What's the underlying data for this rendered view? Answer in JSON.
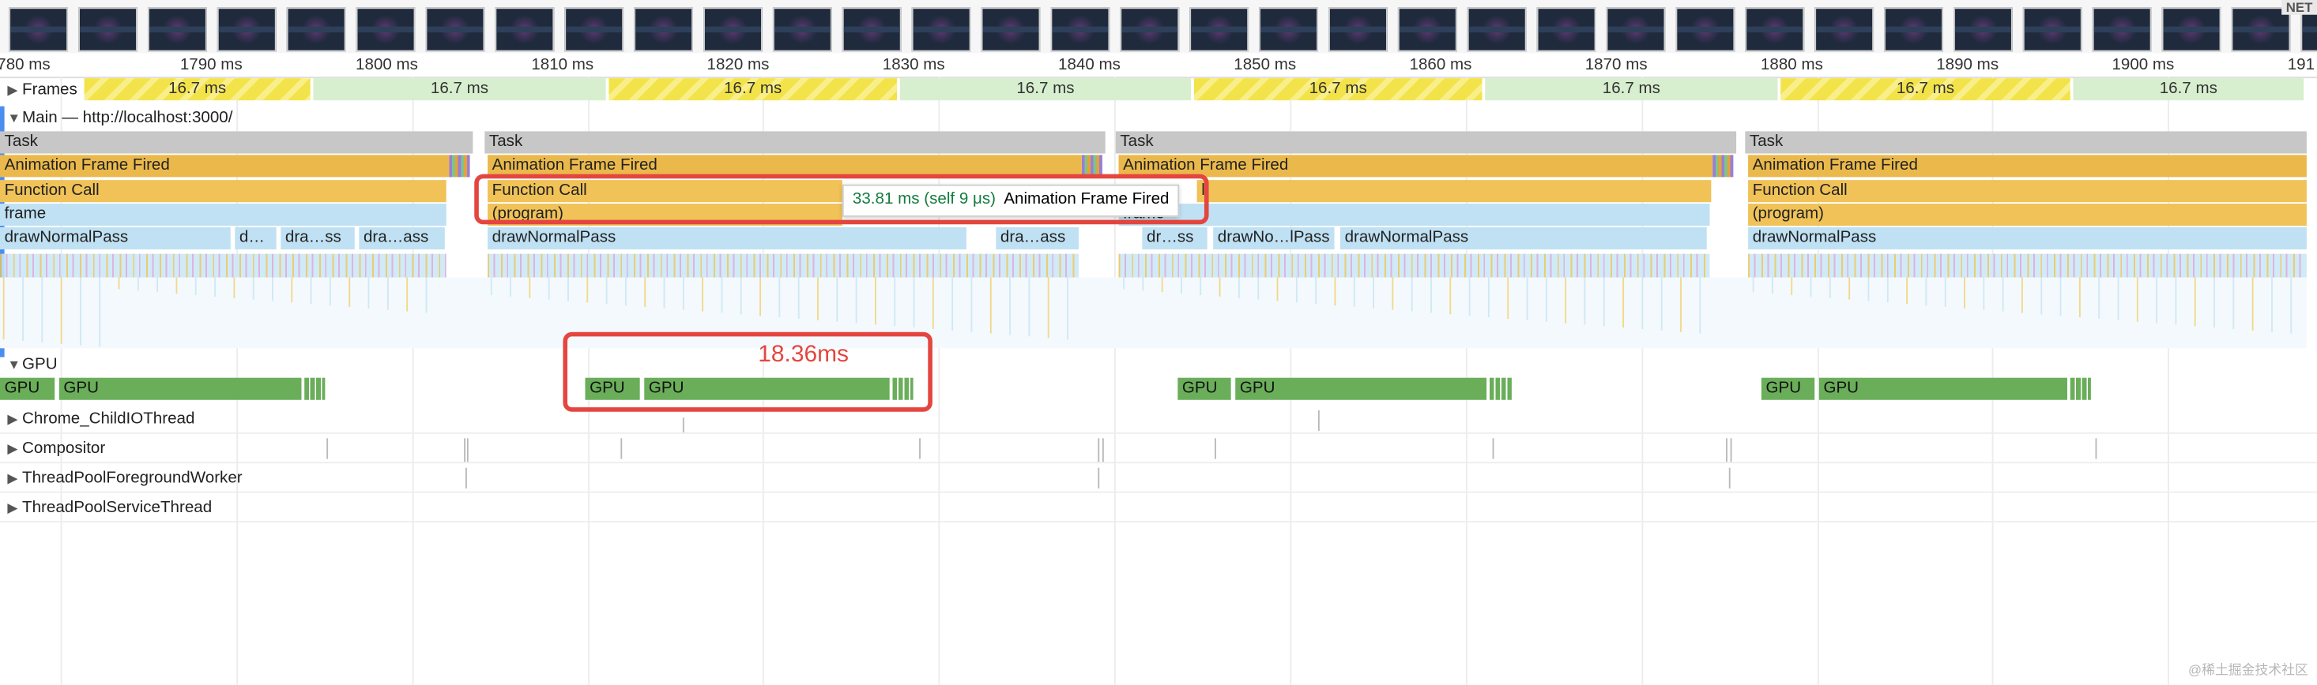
{
  "filmstrip": {
    "thumb_count": 36,
    "net_badge": "NET"
  },
  "ruler": {
    "ticks": [
      "780 ms",
      "1790 ms",
      "1800 ms",
      "1810 ms",
      "1820 ms",
      "1830 ms",
      "1840 ms",
      "1850 ms",
      "1860 ms",
      "1870 ms",
      "1880 ms",
      "1890 ms",
      "1900 ms",
      "191"
    ]
  },
  "frames_track": {
    "label": "Frames",
    "frames": [
      {
        "label": "16.7 ms",
        "kind": "long"
      },
      {
        "label": "16.7 ms",
        "kind": "short"
      },
      {
        "label": "16.7 ms",
        "kind": "long"
      },
      {
        "label": "16.7 ms",
        "kind": "short"
      },
      {
        "label": "16.7 ms",
        "kind": "long"
      },
      {
        "label": "16.7 ms",
        "kind": "short"
      },
      {
        "label": "16.7 ms",
        "kind": "long"
      },
      {
        "label": "16.7 ms",
        "kind": "short"
      }
    ]
  },
  "main_track": {
    "label": "Main — http://localhost:3000/",
    "task_label": "Task",
    "animation_frame_label": "Animation Frame Fired",
    "function_call_label": "Function Call",
    "frame_label": "frame",
    "program_label": "(program)",
    "call_suffix": "ll",
    "draw_labels": [
      "drawNormalPass",
      "d…",
      "dra…ss",
      "dra…ass",
      "drawNormalPass",
      "dra…ass",
      "dr…ss",
      "drawNo…lPass",
      "drawNormalPass",
      "drawNormalPass"
    ]
  },
  "tooltip": {
    "duration": "33.81 ms (self 9 μs)",
    "name": "Animation Frame Fired"
  },
  "gpu_track": {
    "label": "GPU",
    "bar_label": "GPU"
  },
  "measurement": {
    "label": "18.36ms"
  },
  "threads": [
    "Chrome_ChildIOThread",
    "Compositor",
    "ThreadPoolForegroundWorker",
    "ThreadPoolServiceThread"
  ],
  "colors": {
    "task": "#c7c7c7",
    "animation_frame": "#ebb94b",
    "function_call": "#f0c257",
    "draw": "#bfe1f3",
    "gpu": "#6aae5a",
    "highlight": "#e4463f"
  },
  "watermark": "@稀土掘金技术社区"
}
